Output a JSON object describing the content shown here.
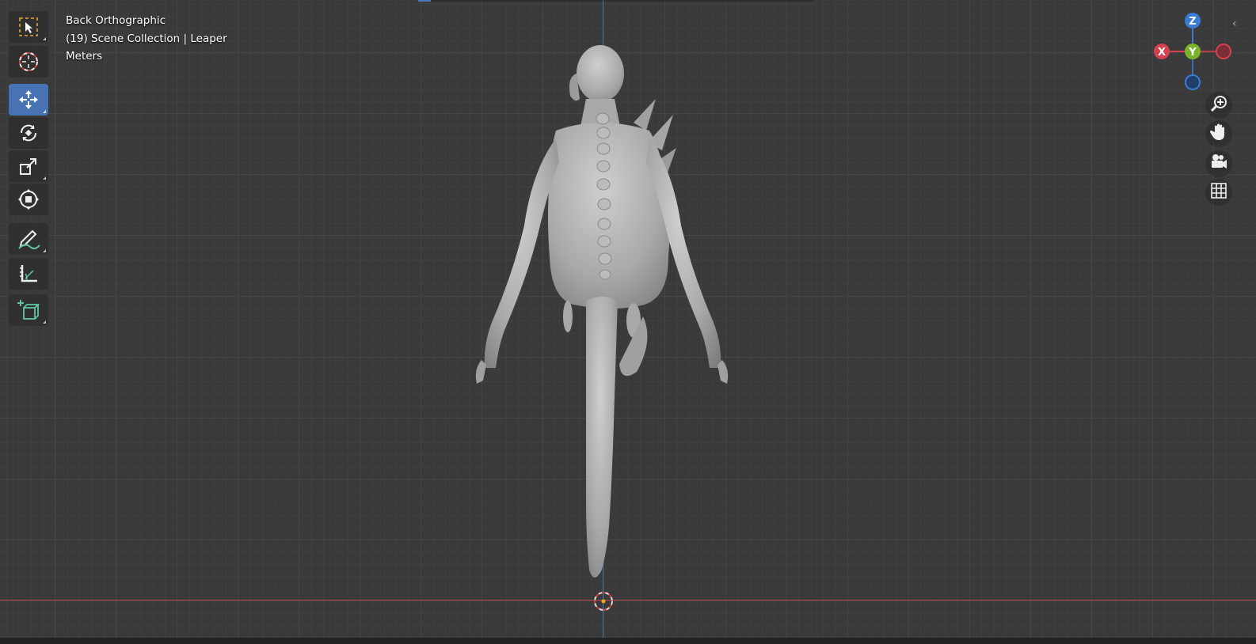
{
  "viewport": {
    "view_name": "Back Orthographic",
    "collection_info": "(19) Scene Collection | Leaper",
    "units": "Meters"
  },
  "toolbar": {
    "tools": [
      {
        "name": "select-box-tool",
        "icon": "select-box-icon",
        "active": false
      },
      {
        "name": "cursor-tool",
        "icon": "cursor-icon",
        "active": false
      },
      {
        "name": "move-tool",
        "icon": "move-icon",
        "active": true
      },
      {
        "name": "rotate-tool",
        "icon": "rotate-icon",
        "active": false
      },
      {
        "name": "scale-tool",
        "icon": "scale-icon",
        "active": false
      },
      {
        "name": "transform-tool",
        "icon": "transform-icon",
        "active": false
      },
      {
        "name": "annotate-tool",
        "icon": "annotate-icon",
        "active": false
      },
      {
        "name": "measure-tool",
        "icon": "measure-icon",
        "active": false
      },
      {
        "name": "add-cube-tool",
        "icon": "add-cube-icon",
        "active": false
      }
    ]
  },
  "gizmo": {
    "z_label": "Z",
    "y_label": "Y",
    "x_label": "X",
    "colors": {
      "x": "#d5404f",
      "y": "#7ab22c",
      "z": "#3a7bd6"
    }
  },
  "nav_buttons": [
    "zoom-icon",
    "pan-hand-icon",
    "camera-icon",
    "grid-icon"
  ],
  "colors": {
    "accent": "#4772b3",
    "x_axis": "#b5444c",
    "z_axis": "#3f6fb0"
  }
}
